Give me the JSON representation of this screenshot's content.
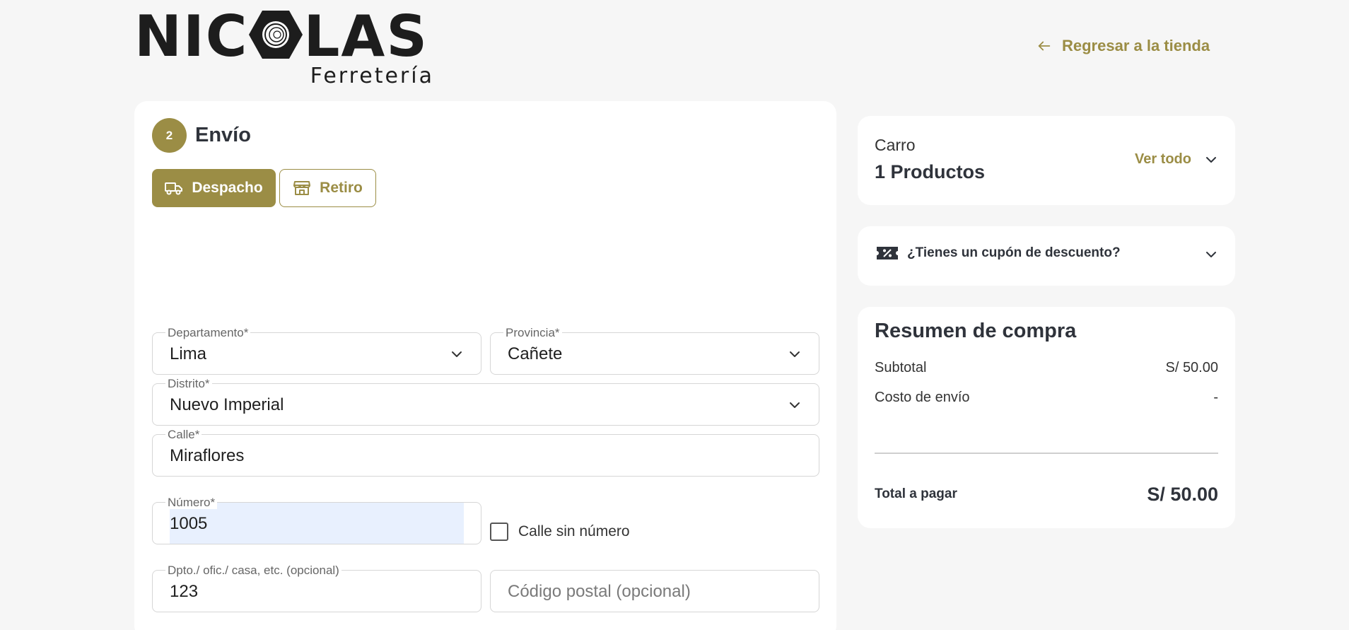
{
  "header": {
    "logo_left": "NIC",
    "logo_right": "LAS",
    "logo_sub": "Ferretería",
    "back_link": "Regresar a la tienda"
  },
  "shipping": {
    "step_number": "2",
    "step_title": "Envío",
    "tab_despacho": "Despacho",
    "tab_retiro": "Retiro",
    "departamento": {
      "label": "Departamento*",
      "value": "Lima"
    },
    "provincia": {
      "label": "Provincia*",
      "value": "Cañete"
    },
    "distrito": {
      "label": "Distrito*",
      "value": "Nuevo Imperial"
    },
    "calle": {
      "label": "Calle*",
      "value": "Miraflores"
    },
    "numero": {
      "label": "Número*",
      "value": "1005"
    },
    "sin_numero": "Calle sin número",
    "dpto": {
      "label": "Dpto./ ofic./ casa, etc. (opcional)",
      "value": "123"
    },
    "postal": {
      "placeholder": "Código postal (opcional)"
    }
  },
  "cart": {
    "title": "Carro",
    "count": "1 Productos",
    "view_all": "Ver todo"
  },
  "coupon": {
    "label": "¿Tienes un cupón de descuento?"
  },
  "summary": {
    "title": "Resumen de compra",
    "subtotal_label": "Subtotal",
    "subtotal_value": "S/ 50.00",
    "shipping_label": "Costo de envío",
    "shipping_value": "-",
    "total_label": "Total a pagar",
    "total_value": "S/ 50.00"
  },
  "colors": {
    "accent": "#9b8d45",
    "background": "#f6f6f6",
    "card": "#ffffff",
    "text": "#2f333b"
  }
}
